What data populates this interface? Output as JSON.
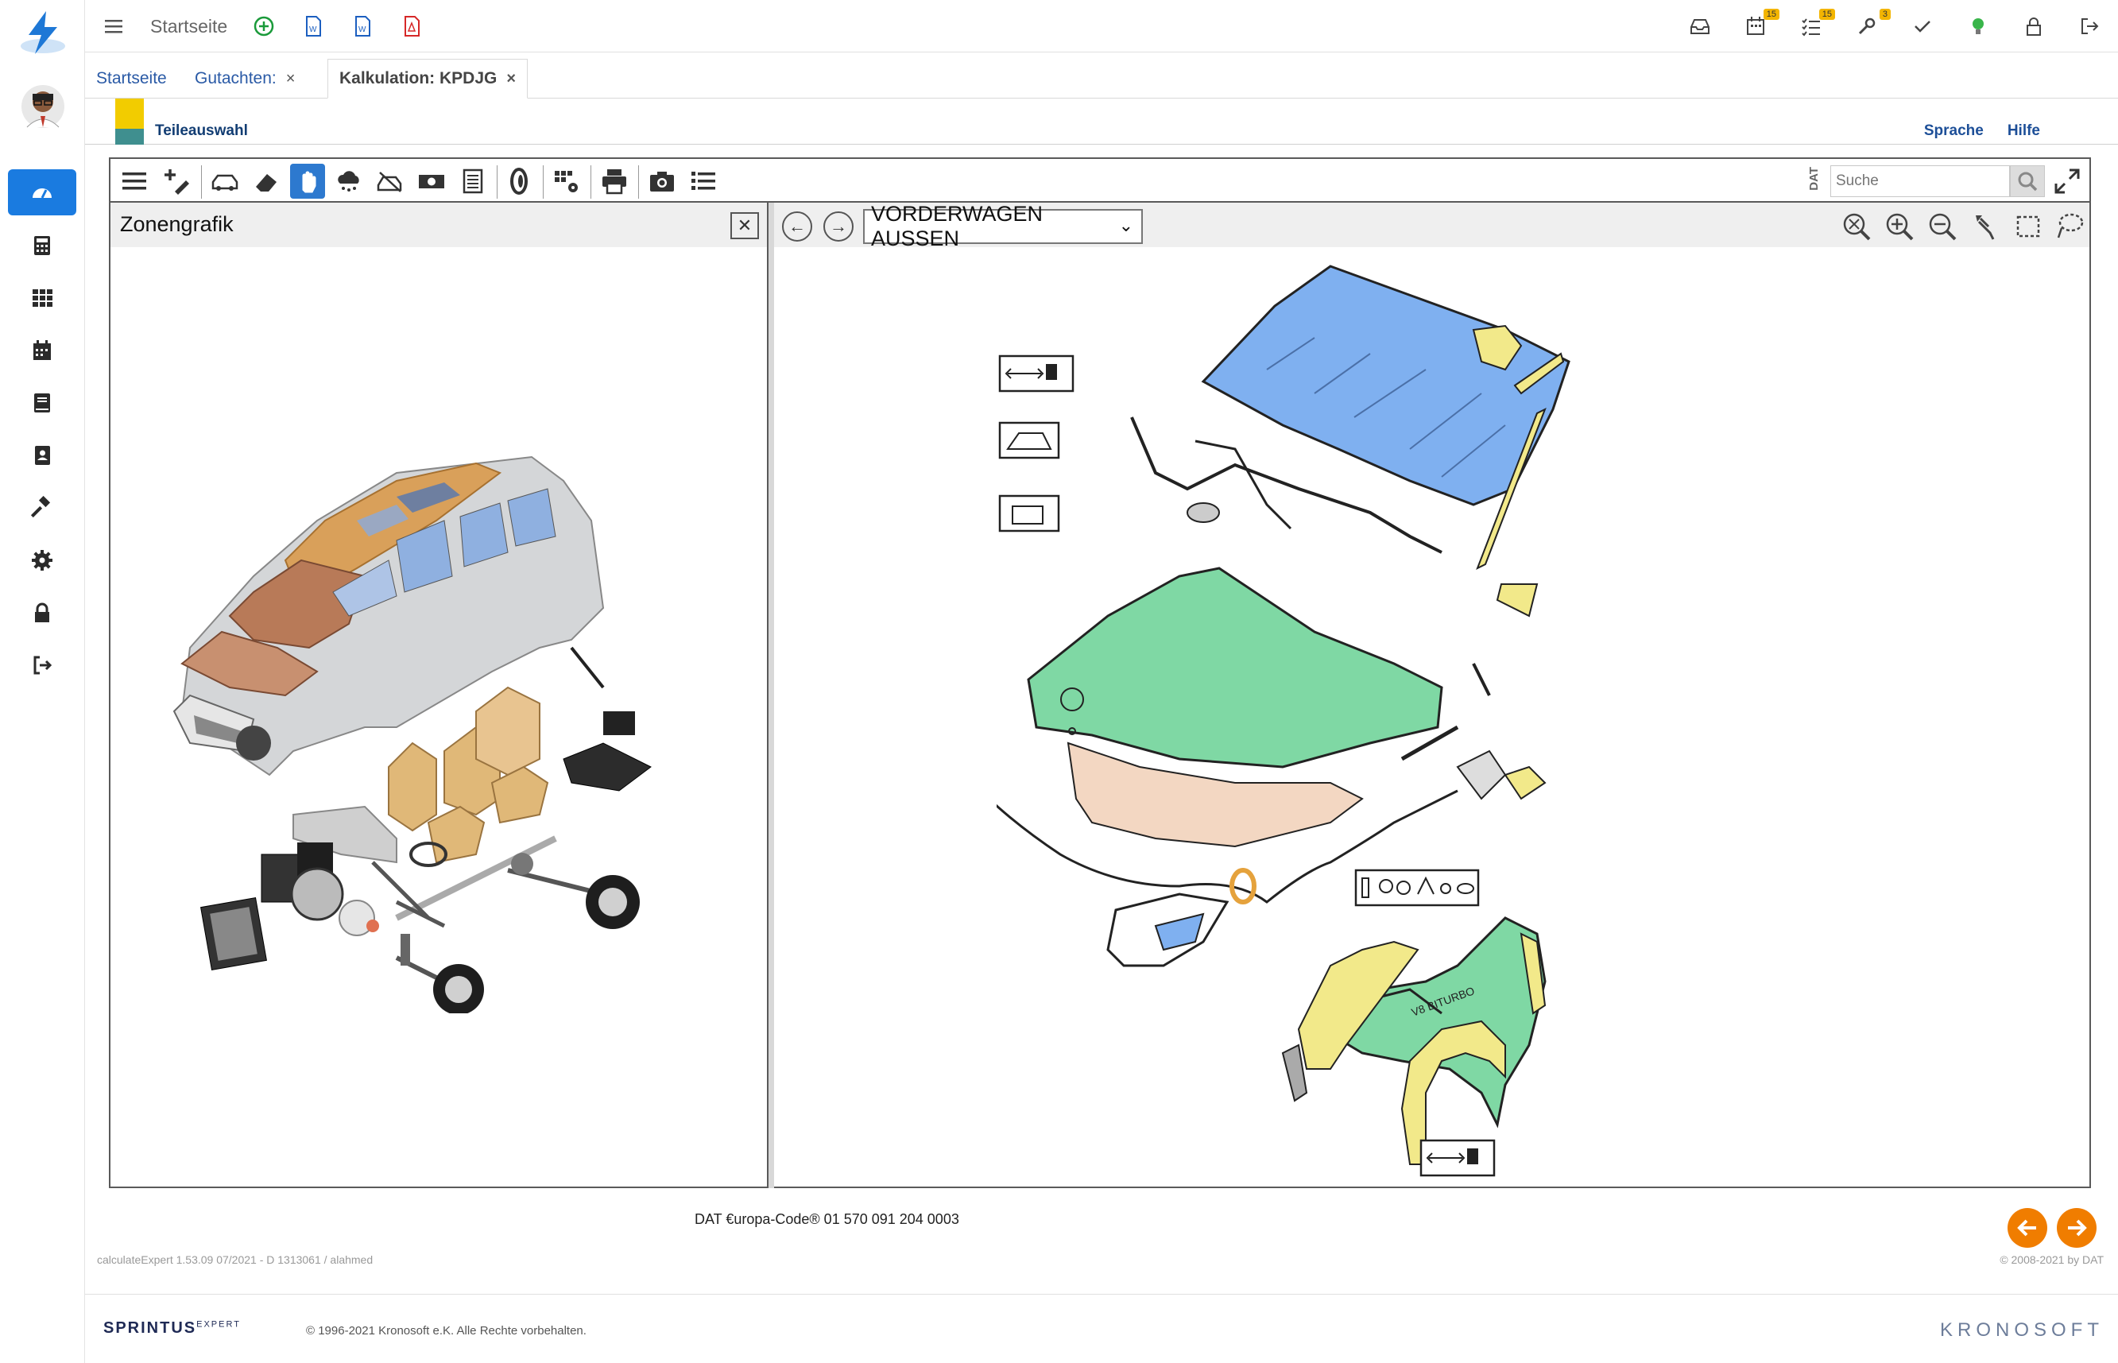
{
  "topbar": {
    "title": "Startseite",
    "badges": {
      "calendar": "15",
      "tasks": "15",
      "tools": "3"
    }
  },
  "tabs": [
    {
      "label": "Startseite"
    },
    {
      "label": "Gutachten:"
    },
    {
      "label": "Kalkulation: KPDJG"
    }
  ],
  "subheader": {
    "logo_text": "DAT",
    "label": "Teileauswahl",
    "links": {
      "language": "Sprache",
      "help": "Hilfe"
    }
  },
  "toolbar": {
    "dat_label": "DAT",
    "search_placeholder": "Suche"
  },
  "left_panel": {
    "title": "Zonengrafik"
  },
  "right_panel": {
    "zone": "VORDERWAGEN AUSSEN",
    "fender_badge": "V8 BITURBO"
  },
  "footer": {
    "europa_code": "DAT €uropa-Code® 01 570 091 204 0003",
    "version_info": "calculateExpert   1.53.09   07/2021 - D   1313061 / alahmed",
    "dat_copyright": "© 2008-2021 by DAT",
    "brand": "SPRINTUS",
    "brand_sup": "EXPERT",
    "copyright": "© 1996-2021 Kronosoft e.K. Alle Rechte vorbehalten.",
    "company": "KRONOSOFT"
  },
  "colors": {
    "accent": "#1a7be0",
    "hood_green": "#7fd8a4",
    "glass_blue": "#7fb0f0",
    "highlight_yellow": "#f2e98a",
    "orange": "#f07d00"
  }
}
